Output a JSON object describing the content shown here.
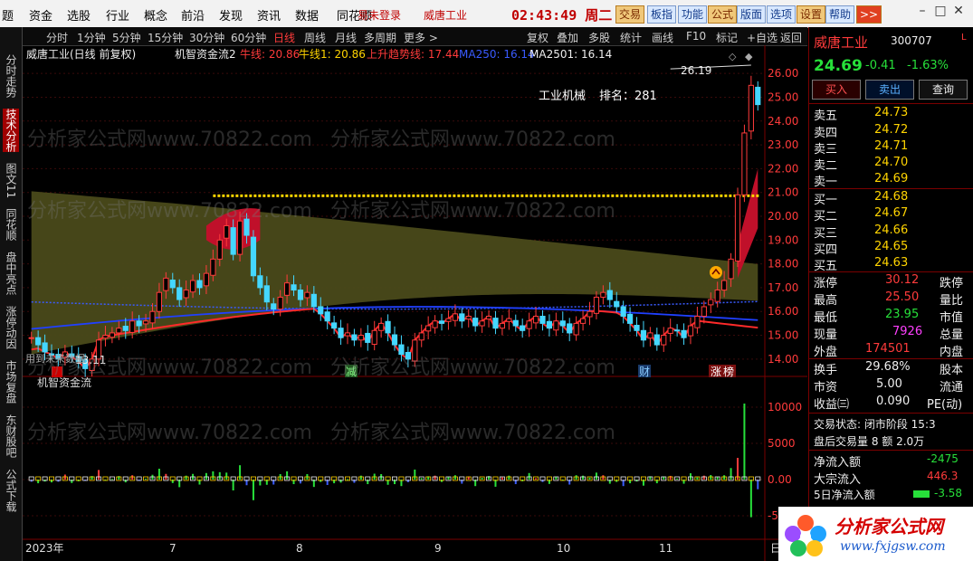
{
  "menu": {
    "items": [
      "题",
      "资金",
      "选股",
      "行业",
      "概念",
      "前沿",
      "发现",
      "资讯",
      "数据",
      "同花顺"
    ],
    "login": "易未登录",
    "stock_top": "威唐工业",
    "clock": "02:43:49",
    "weekday": "周二",
    "right_buttons": [
      "交易",
      "板指",
      "功能",
      "公式",
      "版面",
      "选项",
      "设置",
      "帮助",
      ">>"
    ]
  },
  "left_tabs": [
    "分时走势",
    "技术分析",
    "图文11",
    "同花顺",
    "盘中亮点",
    "涨停动因",
    "市场复盘",
    "东财股吧",
    "公式下载"
  ],
  "toolbar": {
    "periods": [
      "分时",
      "1分钟",
      "5分钟",
      "15分钟",
      "30分钟",
      "60分钟",
      "日线",
      "周线",
      "月线",
      "多周期",
      "更多 >"
    ],
    "tools": [
      "复权",
      "叠加",
      "多股",
      "统计",
      "画线",
      "F10",
      "标记",
      "+自选",
      "返回"
    ]
  },
  "chart": {
    "header_name": "威唐工业(日线 前复权)",
    "indicator_name": "机智资金流2",
    "legend": [
      {
        "label": "牛线: 20.86",
        "color": "#ff3b3b"
      },
      {
        "label": "牛线1: 20.86",
        "color": "#ffd400"
      },
      {
        "label": "上升趋势线: 17.44",
        "color": "#ff3b3b"
      },
      {
        "label": "MA250: 16.14",
        "color": "#3a5bff"
      },
      {
        "label": "MA2501: 16.14",
        "color": "#eeeeee"
      }
    ],
    "industry": "工业机械",
    "rank": "排名：281",
    "high_label": "26.19",
    "low_label": "13.11",
    "future_note": "用到未来数据",
    "markers": [
      "减",
      "财",
      "涨",
      "榜"
    ],
    "price_axis": [
      "26.00",
      "25.00",
      "24.00",
      "23.00",
      "22.00",
      "21.00",
      "20.00",
      "19.00",
      "18.00",
      "17.00",
      "16.00",
      "15.00",
      "14.00"
    ],
    "sub_title": "机智资金流",
    "sub_axis": [
      "10000",
      "5000",
      "0.00",
      "-5000"
    ],
    "date_axis": [
      "2023年",
      "7",
      "8",
      "9",
      "10",
      "11"
    ],
    "date_right": "日"
  },
  "chart_data": {
    "type": "candlestick",
    "ylim": [
      13.5,
      26.5
    ],
    "close": [
      14.9,
      14.6,
      14.3,
      14.2,
      14.0,
      14.3,
      14.1,
      13.9,
      13.6,
      14.0,
      14.8,
      15.0,
      15.1,
      15.3,
      15.2,
      15.6,
      15.4,
      15.6,
      16.0,
      16.8,
      17.4,
      17.0,
      16.5,
      16.9,
      17.3,
      17.0,
      17.6,
      18.2,
      19.0,
      19.6,
      18.4,
      19.8,
      19.2,
      17.5,
      17.0,
      16.4,
      16.1,
      16.6,
      17.2,
      16.9,
      16.5,
      16.8,
      16.2,
      15.9,
      15.6,
      15.3,
      14.9,
      15.1,
      14.8,
      15.0,
      14.7,
      15.2,
      15.5,
      15.1,
      14.6,
      14.2,
      14.0,
      14.8,
      15.1,
      15.4,
      15.6,
      15.5,
      15.7,
      15.9,
      15.6,
      15.8,
      15.4,
      15.6,
      15.8,
      15.3,
      15.5,
      15.7,
      15.4,
      15.2,
      15.6,
      15.8,
      15.5,
      15.3,
      15.6,
      15.4,
      15.1,
      15.5,
      15.7,
      16.0,
      16.6,
      16.8,
      16.5,
      16.2,
      15.8,
      15.5,
      15.2,
      14.8,
      15.1,
      14.6,
      15.0,
      15.3,
      15.2,
      14.9,
      15.4,
      15.8,
      16.2,
      16.5,
      16.9,
      17.3,
      18.2,
      20.9,
      23.5,
      25.5,
      24.69
    ],
    "lines": {
      "bull": 20.86,
      "bull1": 20.86,
      "uptrend": 17.44,
      "ma250": 16.14,
      "ma2501": 16.14
    }
  },
  "right": {
    "name": "威唐工业",
    "code": "300707",
    "price": "24.69",
    "change": "-0.41",
    "pct": "-1.63%",
    "buttons": [
      "买入",
      "卖出",
      "查询"
    ],
    "sells": [
      [
        "卖五",
        "24.73"
      ],
      [
        "卖四",
        "24.72"
      ],
      [
        "卖三",
        "24.71"
      ],
      [
        "卖二",
        "24.70"
      ],
      [
        "卖一",
        "24.69"
      ]
    ],
    "buys": [
      [
        "买一",
        "24.68"
      ],
      [
        "买二",
        "24.67"
      ],
      [
        "买三",
        "24.66"
      ],
      [
        "买四",
        "24.65"
      ],
      [
        "买五",
        "24.63"
      ]
    ],
    "stats": [
      [
        "涨停",
        "30.12",
        "跌停"
      ],
      [
        "最高",
        "25.50",
        "量比"
      ],
      [
        "最低",
        "23.95",
        "市值"
      ],
      [
        "现量",
        "7926",
        "总量"
      ],
      [
        "外盘",
        "174501",
        "内盘"
      ]
    ],
    "stats2": [
      [
        "换手",
        "29.68%",
        "股本"
      ],
      [
        "市资",
        "5.00",
        "流通"
      ],
      [
        "收益㈢",
        "0.090",
        "PE(动)"
      ]
    ],
    "trade_state": "交易状态: 闭市阶段 15:3",
    "after_trade": "盘后交易量 8 额 2.0万",
    "flows": [
      [
        "净流入额",
        "-2475"
      ],
      [
        "大宗流入",
        "446.3"
      ],
      [
        "5日净流入额",
        "-3.58"
      ]
    ]
  },
  "watermark": "分析家公式网www.70822.com",
  "logo": {
    "title": "分析家公式网",
    "url": "www.fxjgsw.com"
  }
}
